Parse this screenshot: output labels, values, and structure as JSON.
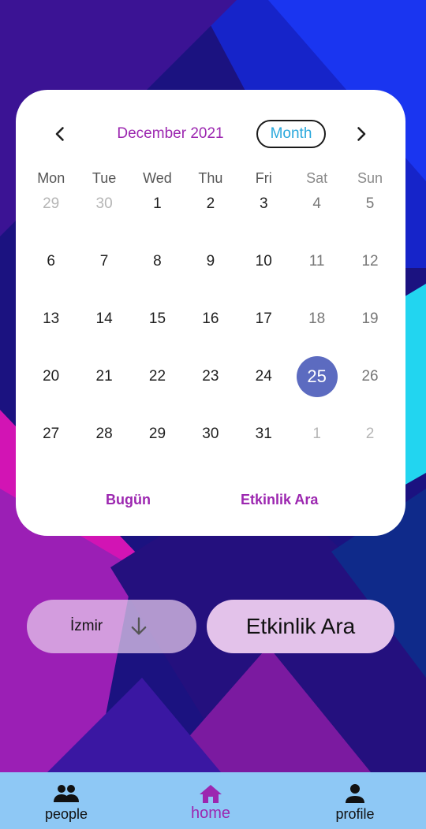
{
  "calendar": {
    "month_label": "December 2021",
    "view_mode": "Month",
    "weekdays": [
      "Mon",
      "Tue",
      "Wed",
      "Thu",
      "Fri",
      "Sat",
      "Sun"
    ],
    "weeks": [
      [
        {
          "day": "29",
          "outside": true
        },
        {
          "day": "30",
          "outside": true
        },
        {
          "day": "1"
        },
        {
          "day": "2"
        },
        {
          "day": "3"
        },
        {
          "day": "4",
          "weekend": true
        },
        {
          "day": "5",
          "weekend": true
        }
      ],
      [
        {
          "day": "6"
        },
        {
          "day": "7"
        },
        {
          "day": "8"
        },
        {
          "day": "9"
        },
        {
          "day": "10"
        },
        {
          "day": "11",
          "weekend": true
        },
        {
          "day": "12",
          "weekend": true
        }
      ],
      [
        {
          "day": "13"
        },
        {
          "day": "14"
        },
        {
          "day": "15"
        },
        {
          "day": "16"
        },
        {
          "day": "17"
        },
        {
          "day": "18",
          "weekend": true
        },
        {
          "day": "19",
          "weekend": true
        }
      ],
      [
        {
          "day": "20"
        },
        {
          "day": "21"
        },
        {
          "day": "22"
        },
        {
          "day": "23"
        },
        {
          "day": "24"
        },
        {
          "day": "25",
          "weekend": true,
          "selected": true
        },
        {
          "day": "26",
          "weekend": true
        }
      ],
      [
        {
          "day": "27"
        },
        {
          "day": "28"
        },
        {
          "day": "29"
        },
        {
          "day": "30"
        },
        {
          "day": "31"
        },
        {
          "day": "1",
          "outside": true
        },
        {
          "day": "2",
          "outside": true
        }
      ]
    ],
    "today_label": "Bugün",
    "search_label": "Etkinlik Ara",
    "prev_icon": "chevron-left-icon",
    "next_icon": "chevron-right-icon",
    "selected_color": "#5c6bc0",
    "accent_color": "#9c27b0"
  },
  "filters": {
    "city_value": "İzmir",
    "city_icon": "arrow-down-icon",
    "search_button_label": "Etkinlik Ara"
  },
  "bottom_nav": {
    "items": [
      {
        "label": "people",
        "icon": "people-icon"
      },
      {
        "label": "home",
        "icon": "home-icon",
        "active": true
      },
      {
        "label": "profile",
        "icon": "person-icon"
      }
    ],
    "background": "#8ec8f5"
  }
}
